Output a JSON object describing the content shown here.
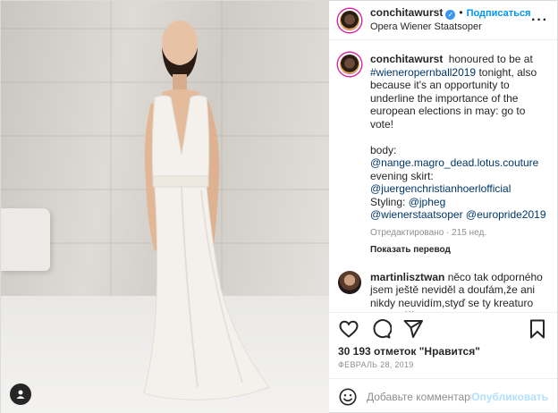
{
  "header": {
    "username": "conchitawurst",
    "verified_badge": "✓",
    "separator": "•",
    "follow_label": "Подписаться",
    "location": "Opera Wiener Staatsoper",
    "more_icon": "more-horizontal-icon"
  },
  "caption": {
    "username": "conchitawurst",
    "parts": {
      "p1": "honoured to be at",
      "hashtag1": "#wieneropernball2019",
      "p2": "tonight, also because it's an opportunity to underline the importance of the european elections in may: go to vote!",
      "body_label": "body:",
      "mention1": "@nange.magro_dead.lotus.couture",
      "skirt_label": "evening skirt:",
      "mention2": "@juergenchristianhoerlofficial",
      "styling_label": "Styling:",
      "mention3": "@jpheg",
      "mention4": "@wienerstaatsoper",
      "mention5": "@europride2019"
    },
    "meta": "Отредактировано · 215 нед.",
    "translate_label": "Показать перевод"
  },
  "comments": [
    {
      "username": "martinlisztwan",
      "text": "něco tak odporného jsem ještě neviděl a doufám,že ani nikdy neuvidím,styď se ty kreaturo zasraná!!"
    }
  ],
  "actions": {
    "like_icon": "heart-icon",
    "comment_icon": "comment-icon",
    "share_icon": "send-icon",
    "save_icon": "bookmark-icon"
  },
  "likes_text": "30 193 отметок \"Нравится\"",
  "date_text": "ФЕВРАЛЬ 28, 2019",
  "add_comment": {
    "emoji_icon": "emoji-icon",
    "placeholder": "Добавьте комментарий...",
    "publish_label": "Опубликовать"
  },
  "colors": {
    "accent": "#0095f6",
    "link": "#00376b",
    "muted": "#8e8e8e",
    "publish_disabled": "#b2dffc"
  }
}
